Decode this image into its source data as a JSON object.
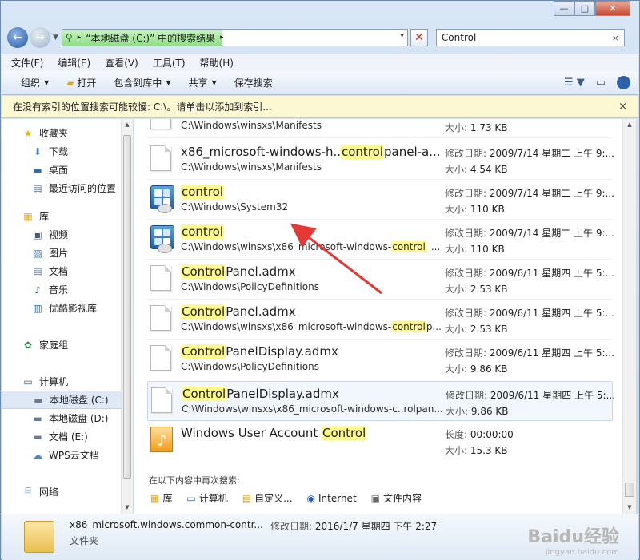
{
  "window": {
    "min_label": "—",
    "max_label": "□",
    "close_label": "✕"
  },
  "address": {
    "path_label": "“本地磁盘 (C:)” 中的搜索结果",
    "arrow": "▸",
    "drop": "▾"
  },
  "search": {
    "value": "Control",
    "clear": "×"
  },
  "menu": [
    "文件(F)",
    "编辑(E)",
    "查看(V)",
    "工具(T)",
    "帮助(H)"
  ],
  "toolbar": {
    "organize": "组织",
    "open": "打开",
    "include": "包含到库中",
    "share": "共享",
    "save_search": "保存搜索"
  },
  "infobar": {
    "text": "在没有索引的位置搜索可能较慢: C:\\。请单击以添加到索引...",
    "close": "×"
  },
  "sidebar": {
    "favorites": "收藏夹",
    "fav_items": [
      "下载",
      "桌面",
      "最近访问的位置"
    ],
    "libraries": "库",
    "lib_items": [
      "视频",
      "图片",
      "文档",
      "音乐",
      "优酷影视库"
    ],
    "homegroup": "家庭组",
    "computer": "计算机",
    "drives": [
      "本地磁盘 (C:)",
      "本地磁盘 (D:)",
      "文档 (E:)",
      "WPS云文档"
    ],
    "network": "网络"
  },
  "results": [
    {
      "name_pre": "",
      "name_hl": "",
      "name_post": "",
      "path": "C:\\Windows\\winsxs\\Manifests",
      "meta1_label": "",
      "meta1_value": "",
      "meta2_label": "大小:",
      "meta2_value": "1.73 KB",
      "icon": "doc-icon"
    },
    {
      "name_pre": "x86_microsoft-windows-h..",
      "name_hl": "control",
      "name_post": "panel-a...",
      "path": "C:\\Windows\\winsxs\\Manifests",
      "meta1_label": "修改日期:",
      "meta1_value": "2009/7/14 星期二 上午 9:...",
      "meta2_label": "大小:",
      "meta2_value": "4.54 KB",
      "icon": "doc-icon"
    },
    {
      "name_pre": "",
      "name_hl": "control",
      "name_post": "",
      "path": "C:\\Windows\\System32",
      "meta1_label": "修改日期:",
      "meta1_value": "2009/7/14 星期二 上午 9:...",
      "meta2_label": "大小:",
      "meta2_value": "110 KB",
      "icon": "control-panel-icon"
    },
    {
      "name_pre": "",
      "name_hl": "control",
      "name_post": "",
      "path_pre": "C:\\Windows\\winsxs\\x86_microsoft-windows-",
      "path_hl": "control",
      "path_post": "_...",
      "meta1_label": "修改日期:",
      "meta1_value": "2009/7/14 星期二 上午 9:...",
      "meta2_label": "大小:",
      "meta2_value": "110 KB",
      "icon": "control-panel-icon"
    },
    {
      "name_pre": "",
      "name_hl": "Control",
      "name_post": "Panel.admx",
      "path": "C:\\Windows\\PolicyDefinitions",
      "meta1_label": "修改日期:",
      "meta1_value": "2009/6/11 星期四 上午 5:...",
      "meta2_label": "大小:",
      "meta2_value": "2.53 KB",
      "icon": "doc-icon"
    },
    {
      "name_pre": "",
      "name_hl": "Control",
      "name_post": "Panel.admx",
      "path_pre": "C:\\Windows\\winsxs\\x86_microsoft-windows-",
      "path_hl": "control",
      "path_post": "p...",
      "meta1_label": "修改日期:",
      "meta1_value": "2009/6/11 星期四 上午 5:...",
      "meta2_label": "大小:",
      "meta2_value": "2.53 KB",
      "icon": "doc-icon"
    },
    {
      "name_pre": "",
      "name_hl": "Control",
      "name_post": "PanelDisplay.admx",
      "path": "C:\\Windows\\PolicyDefinitions",
      "meta1_label": "修改日期:",
      "meta1_value": "2009/6/11 星期四 上午 5:...",
      "meta2_label": "大小:",
      "meta2_value": "9.86 KB",
      "icon": "doc-icon"
    },
    {
      "name_pre": "",
      "name_hl": "Control",
      "name_post": "PanelDisplay.admx",
      "path": "C:\\Windows\\winsxs\\x86_microsoft-windows-c..rolpan...",
      "meta1_label": "修改日期:",
      "meta1_value": "2009/6/11 星期四 上午 5:...",
      "meta2_label": "大小:",
      "meta2_value": "9.86 KB",
      "icon": "doc-icon"
    },
    {
      "name_pre": "Windows User Account ",
      "name_hl": "Control",
      "name_post": "",
      "path": "",
      "meta1_label": "长度:",
      "meta1_value": "00:00:00",
      "meta2_label": "大小:",
      "meta2_value": "15.3 KB",
      "icon": "music-file-icon"
    }
  ],
  "search_again": {
    "label": "在以下内容中再次搜索:",
    "links": [
      "库",
      "计算机",
      "自定义...",
      "Internet",
      "文件内容"
    ]
  },
  "details": {
    "name": "x86_microsoft.windows.common-contr...",
    "meta_label": "修改日期:",
    "meta_value": "2016/1/7 星期四 下午 2:27",
    "type": "文件夹"
  },
  "watermark": {
    "main": "Baidu经验",
    "sub": "jingyan.baidu.com"
  },
  "colors": {
    "highlight": "#fffa89",
    "annotation_arrow": "#e53935"
  }
}
